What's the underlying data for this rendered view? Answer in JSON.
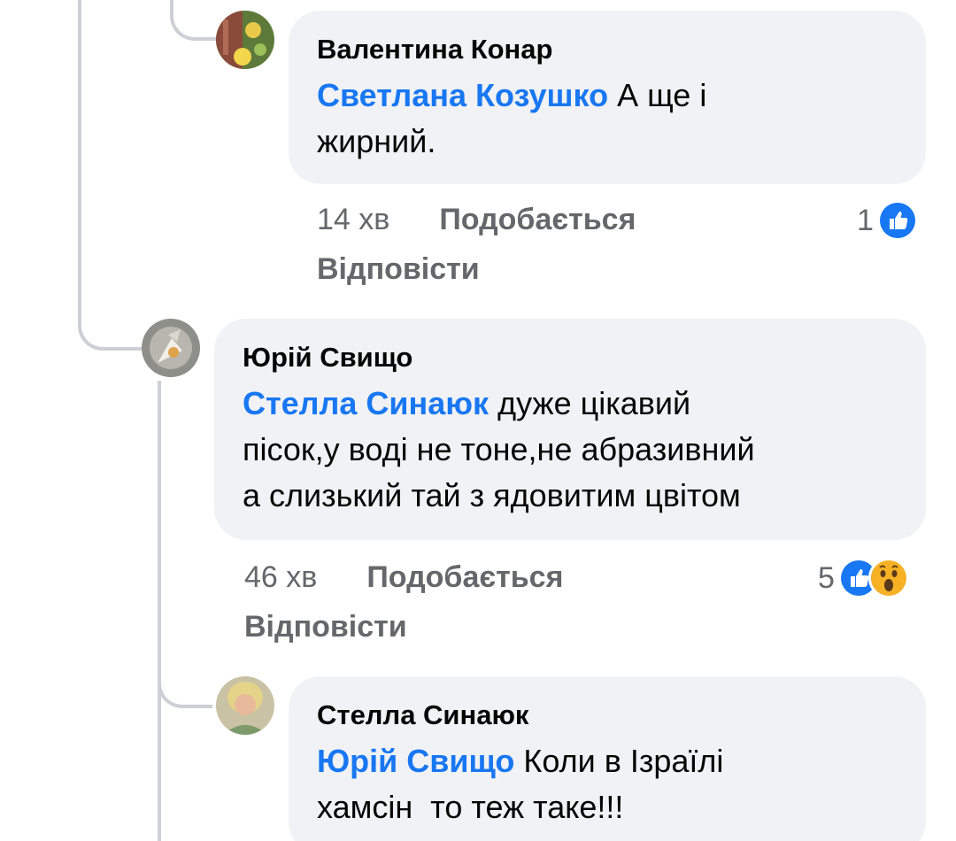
{
  "comments": [
    {
      "author": "Валентина Конар",
      "mention": "Светлана Козушко",
      "line1": " А ще і",
      "line2": "жирний.",
      "time": "14 хв",
      "like_label": "Подобається",
      "reply_label": "Відповісти",
      "reaction_count": "1",
      "reactions": [
        "like-icon"
      ]
    },
    {
      "author": "Юрій Свищо",
      "mention": "Стелла Синаюк",
      "line1": " дуже цікавий",
      "line2": "пісок,у воді не тоне,не абразивний",
      "line3": "а слизький тай з ядовитим цвітом",
      "time": "46 хв",
      "like_label": "Подобається",
      "reply_label": "Відповісти",
      "reaction_count": "5",
      "reactions": [
        "like-icon",
        "wow-icon"
      ]
    },
    {
      "author": "Стелла Синаюк",
      "mention": "Юрій Свищо",
      "line1": " Коли в Ізраїлі",
      "line2": "хамсін  то теж таке!!!"
    }
  ],
  "colors": {
    "mention": "#1877f2",
    "bubble": "#f0f2f5",
    "meta": "#65676b",
    "thread_line": "#ccd0d5"
  }
}
